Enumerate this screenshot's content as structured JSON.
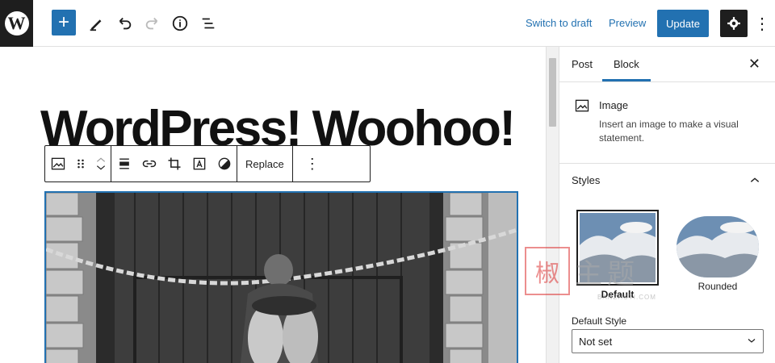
{
  "topbar": {
    "logo": "W",
    "add_label": "+",
    "switch_to_draft": "Switch to draft",
    "preview": "Preview",
    "update": "Update",
    "icons": [
      "wordpress-logo",
      "add",
      "pencil",
      "undo",
      "redo",
      "info",
      "list-view",
      "gear",
      "more-vertical"
    ]
  },
  "editor": {
    "post_title": "WordPress! Woohoo!",
    "block_toolbar": {
      "replace_label": "Replace",
      "icons": [
        "image",
        "drag-handle",
        "move-up-down",
        "align",
        "link",
        "crop",
        "text-overlay",
        "duotone",
        "more-vertical"
      ]
    }
  },
  "sidebar": {
    "tabs": [
      "Post",
      "Block"
    ],
    "active_tab": "Block",
    "close_label": "✕",
    "block_card": {
      "title": "Image",
      "description": "Insert an image to make a visual statement."
    },
    "styles": {
      "heading": "Styles",
      "options": [
        {
          "label": "Default",
          "selected": true
        },
        {
          "label": "Rounded",
          "selected": false
        }
      ],
      "default_style_label": "Default Style",
      "default_style_value": "Not set"
    }
  },
  "watermark": {
    "seal": "椒",
    "text": "主题",
    "url": "BANZHUTI.COM"
  },
  "colors": {
    "accent": "#2271b1",
    "dark": "#1e1e1e"
  }
}
